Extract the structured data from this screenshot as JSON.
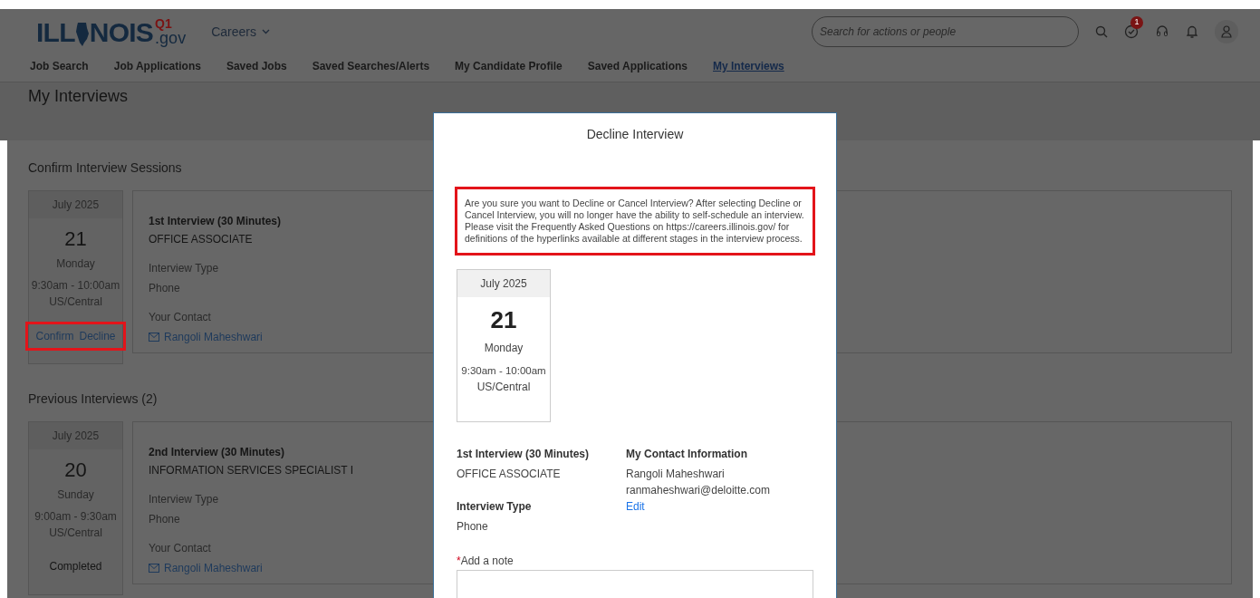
{
  "header": {
    "logo": {
      "left": "ILL",
      "right": "NOIS",
      "badge": "Q1",
      "suffix": ".gov"
    },
    "menu": "Careers",
    "search": {
      "placeholder": "Search for actions or people"
    },
    "todo_badge": "1"
  },
  "nav": [
    {
      "label": "Job Search",
      "selected": false
    },
    {
      "label": "Job Applications",
      "selected": false
    },
    {
      "label": "Saved Jobs",
      "selected": false
    },
    {
      "label": "Saved Searches/Alerts",
      "selected": false
    },
    {
      "label": "My Candidate Profile",
      "selected": false
    },
    {
      "label": "Saved Applications",
      "selected": false
    },
    {
      "label": "My Interviews",
      "selected": true
    }
  ],
  "page_title": "My Interviews",
  "sections": [
    {
      "title": "Confirm Interview Sessions",
      "interviews": [
        {
          "month": "July 2025",
          "day": "21",
          "weekday": "Monday",
          "time": "9:30am - 10:00am",
          "zone": "US/Central",
          "actions": [
            "Confirm",
            "Decline"
          ],
          "actions_highlighted": true,
          "title": "1st Interview (30 Minutes)",
          "position": "OFFICE ASSOCIATE",
          "type_label": "Interview Type",
          "type": "Phone",
          "contact_label": "Your Contact",
          "contact": "Rangoli Maheshwari"
        }
      ]
    },
    {
      "title": "Previous Interviews (2)",
      "interviews": [
        {
          "month": "July 2025",
          "day": "20",
          "weekday": "Sunday",
          "time": "9:00am - 9:30am",
          "zone": "US/Central",
          "status": "Completed",
          "title": "2nd Interview (30 Minutes)",
          "position": "INFORMATION SERVICES SPECIALIST I",
          "type_label": "Interview Type",
          "type": "Phone",
          "contact_label": "Your Contact",
          "contact": "Rangoli Maheshwari"
        }
      ]
    }
  ],
  "dialog": {
    "title": "Decline Interview",
    "notice": "Are you sure you want to Decline or Cancel Interview? After selecting Decline or Cancel Interview, you will no longer have the ability to self-schedule an interview. Please visit the Frequently Asked Questions on https://careers.illinois.gov/ for definitions of the hyperlinks available at different stages in the interview process.",
    "notice_highlighted": true,
    "date": {
      "month": "July 2025",
      "day": "21",
      "weekday": "Monday",
      "time": "9:30am - 10:00am",
      "zone": "US/Central"
    },
    "interview_title": "1st Interview (30 Minutes)",
    "position": "OFFICE ASSOCIATE",
    "type_label": "Interview Type",
    "type": "Phone",
    "contact_heading": "My Contact Information",
    "contact_name": "Rangoli Maheshwari",
    "contact_email": "ranmaheshwari@deloitte.com",
    "edit": "Edit",
    "required_mark": "*",
    "note_label": "Add a note"
  }
}
